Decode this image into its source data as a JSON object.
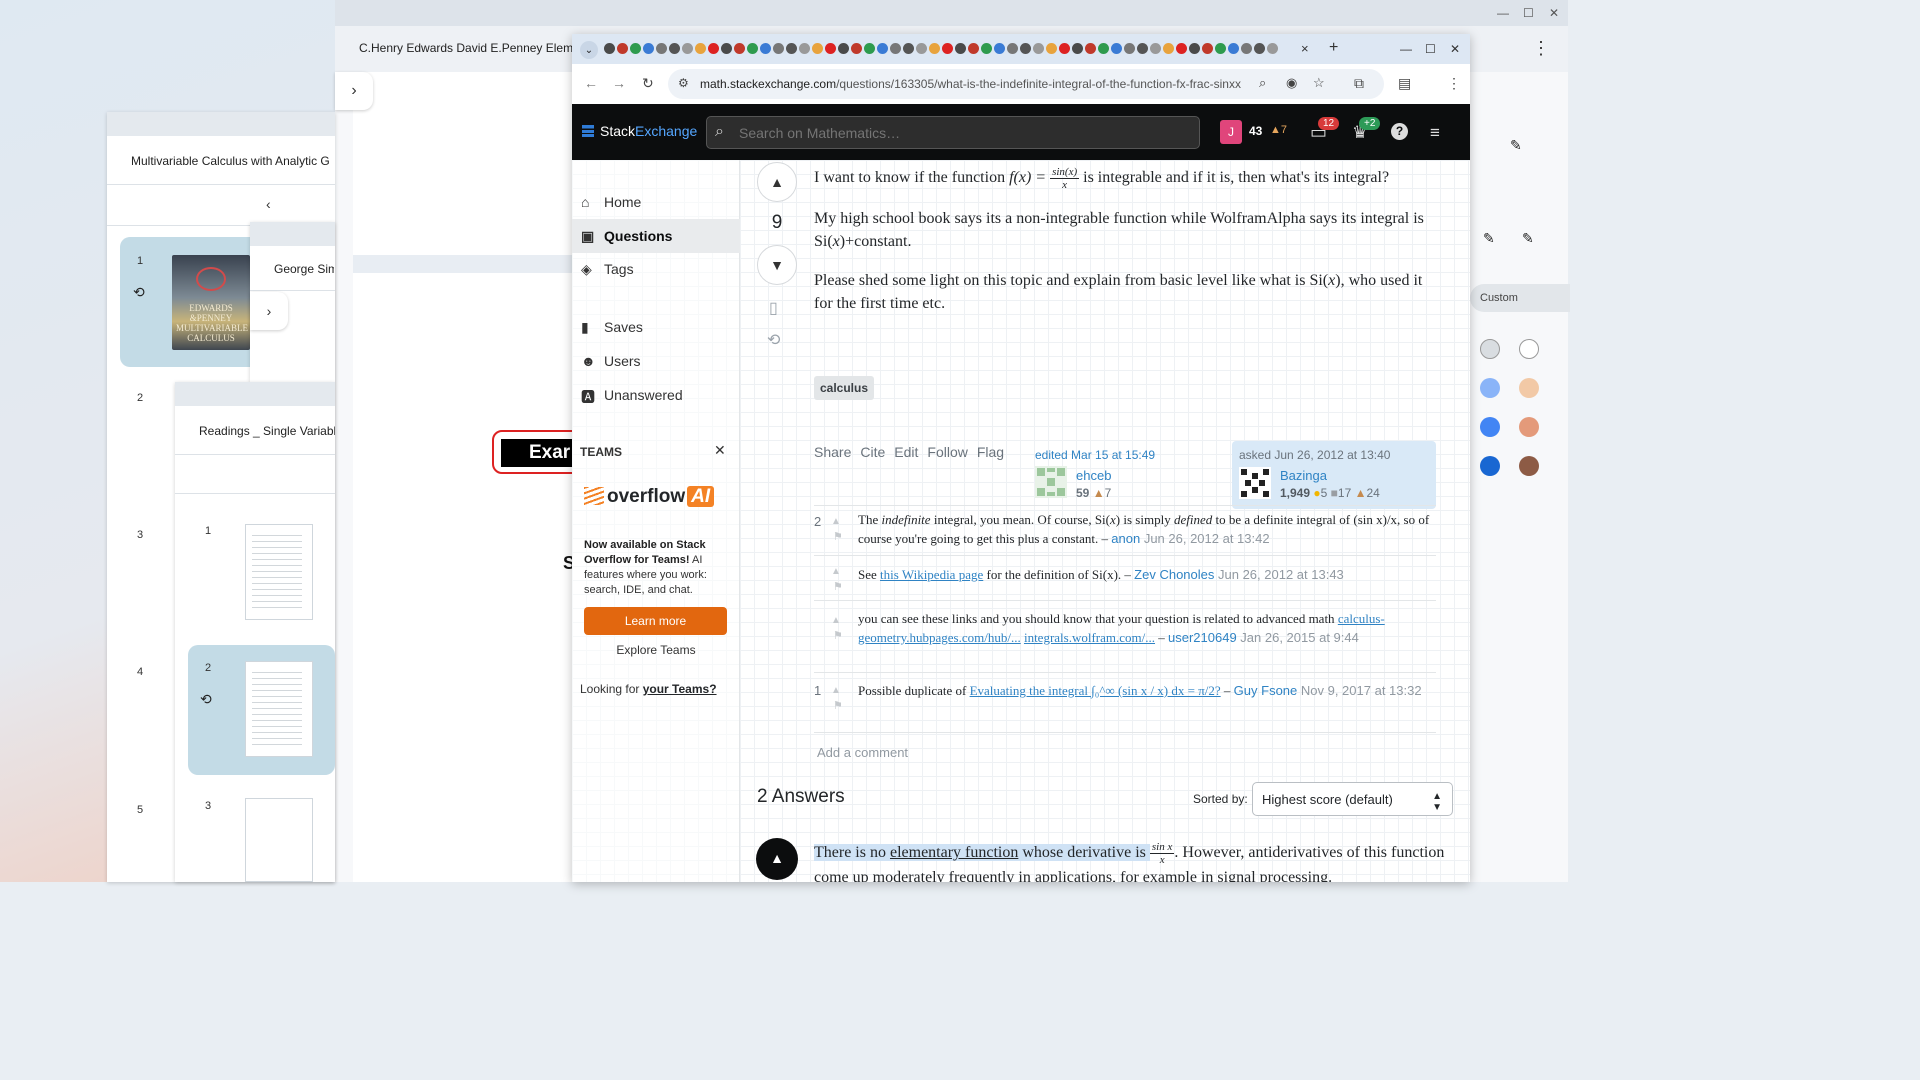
{
  "pdf_window": {
    "tab_title": "C.Henry Edwards David E.Penney Eleme",
    "exam_label": "Exar",
    "page_fragment": "S"
  },
  "thumbnail_windows": {
    "w1": {
      "title": "Multivariable Calculus with Analytic G",
      "pages": [
        {
          "num": "1"
        }
      ],
      "cover_text": "EDWARDS & PENNEY MULTIVARIABLE CALCULUS"
    },
    "w2": {
      "title": "George Sim"
    },
    "w3": {
      "title": "Readings _ Single Variable",
      "side_nums": [
        "2",
        "3",
        "4",
        "5"
      ],
      "pages": [
        "1",
        "2",
        "3"
      ]
    }
  },
  "annotation_panel": {
    "custom_label": "Custom",
    "swatches": [
      "#d9dde1",
      "#ffffff",
      "#8ab4f8",
      "#f2c9a6",
      "#4285f4",
      "#e49a7a",
      "#1967d2",
      "#8d5b45"
    ]
  },
  "browser": {
    "url_domain": "math.stackexchange.com",
    "url_path": "/questions/163305/what-is-the-indefinite-integral-of-the-function-fx-frac-sinxx",
    "tab_close": "×",
    "new_tab": "+"
  },
  "se_header": {
    "logo_stack": "Stack",
    "logo_exchange": "Exchange",
    "search_placeholder": "Search on Mathematics…",
    "avatar_letter": "J",
    "reputation": "43",
    "bronze": "7",
    "inbox_count": "12",
    "achievements": "+2"
  },
  "sidebar": {
    "items": [
      {
        "label": "Home",
        "icon": "home-icon"
      },
      {
        "label": "Questions",
        "icon": "questions-icon"
      },
      {
        "label": "Tags",
        "icon": "tag-icon"
      },
      {
        "label": "Saves",
        "icon": "bookmark-icon"
      },
      {
        "label": "Users",
        "icon": "users-icon"
      },
      {
        "label": "Unanswered",
        "icon": "unanswered-icon"
      }
    ],
    "teams_header": "TEAMS",
    "overflow_text": "overflow",
    "overflow_ai": "AI",
    "teams_desc_bold": "Now available on Stack Overflow for Teams!",
    "teams_desc_rest": " AI features where you work: search, IDE, and chat.",
    "learn_more": "Learn more",
    "explore_teams": "Explore Teams",
    "looking_for": "Looking for ",
    "your_teams": "your Teams?"
  },
  "question": {
    "score": "9",
    "p1_a": "I want to know if the function ",
    "p1_math": "f(x) =",
    "p1_num": "sin(x)",
    "p1_den": "x",
    "p1_b": " is integrable and if it is, then what's its integral?",
    "p2_a": "My high school book says its a non-integrable function while WolframAlpha says its integral is Si(",
    "p2_x": "x",
    "p2_b": ")+constant.",
    "p3_a": "Please shed some light on this topic and explain from basic level like what is Si(",
    "p3_x": "x",
    "p3_b": "), who used it for the first time etc.",
    "tag": "calculus",
    "menu": [
      "Share",
      "Cite",
      "Edit",
      "Follow",
      "Flag"
    ],
    "edited": {
      "text": "edited Mar 15 at 15:49",
      "user": "ehceb",
      "rep": "59",
      "bronze": "7"
    },
    "asked": {
      "text": "asked Jun 26, 2012 at 13:40",
      "user": "Bazinga",
      "rep": "1,949",
      "gold": "5",
      "silver": "17",
      "bronze": "24"
    }
  },
  "comments": [
    {
      "score": "2",
      "a": "The ",
      "i1": "indefinite",
      "b": " integral, you mean. Of course, Si(",
      "x": "x",
      "c": ") is simply ",
      "i2": "defined",
      "d": " to be a definite integral of (sin ",
      "e": "x)/x, so of course you're going to get this plus a constant. – ",
      "user": "anon",
      "date": " Jun 26, 2012 at 13:42"
    },
    {
      "score": "",
      "a": "See ",
      "link": "this Wikipedia page",
      "b": " for the definition of Si(x). – ",
      "user": "Zev Chonoles",
      "date": " Jun 26, 2012 at 13:43"
    },
    {
      "score": "",
      "a": "you can see these links and you should know that your question is related to advanced math ",
      "link1": "calculus-geometry.hubpages.com/hub/...",
      "link2": "integrals.wolfram.com/...",
      "sep": " – ",
      "user": "user210649",
      "date": " Jan 26, 2015 at 9:44"
    },
    {
      "score": "1",
      "a": "Possible duplicate of ",
      "link": "Evaluating the integral ∫₀^∞ (sin x / x) dx = π/2?",
      "sep": " – ",
      "user": "Guy Fsone",
      "date": " Nov 9, 2017 at 13:32"
    }
  ],
  "add_comment": "Add a comment",
  "answers": {
    "header": "2 Answers",
    "sorted_by": "Sorted by:",
    "sort_value": "Highest score (default)",
    "first_a": "There is no ",
    "first_link": "elementary function",
    "first_b": " whose derivative is ",
    "first_num": "sin x",
    "first_den": "x",
    "first_c": ". However, antiderivatives of this function come up moderately frequently in applications, for example in signal processing."
  }
}
